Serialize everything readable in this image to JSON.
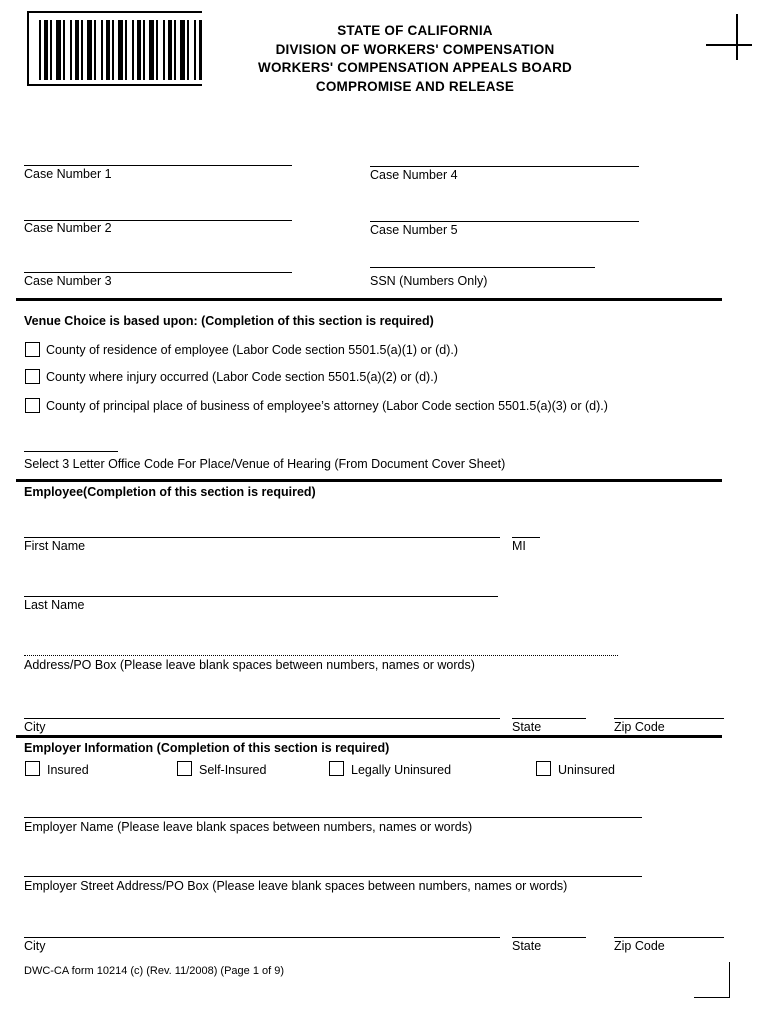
{
  "header": {
    "line1": "STATE OF CALIFORNIA",
    "line2": "DIVISION OF WORKERS' COMPENSATION",
    "line3": "WORKERS' COMPENSATION APPEALS BOARD",
    "line4": "COMPROMISE AND RELEASE"
  },
  "case_fields": {
    "case1": "Case Number 1",
    "case2": "Case Number 2",
    "case3": "Case Number 3",
    "case4": "Case Number 4",
    "case5": "Case Number 5",
    "ssn": "SSN (Numbers Only)"
  },
  "venue": {
    "heading": "Venue Choice is based upon:  (Completion of this section is required)",
    "options": [
      "County of residence of employee (Labor Code section 5501.5(a)(1) or (d).)",
      "County where injury occurred (Labor Code section 5501.5(a)(2) or (d).)",
      "County of principal place of business of employee’s attorney (Labor Code section 5501.5(a)(3) or (d).)"
    ],
    "office_code_label": "Select 3 Letter Office Code For Place/Venue of Hearing (From Document Cover Sheet)"
  },
  "employee": {
    "heading": "Employee(Completion of this section is required)",
    "first_name": "First Name",
    "mi": "MI",
    "last_name": "Last Name",
    "address": "Address/PO Box (Please leave blank spaces between numbers, names or words)",
    "city": "City",
    "state": "State",
    "zip": "Zip Code"
  },
  "employer": {
    "heading": "Employer Information (Completion of this section is required)",
    "insurance_options": [
      "Insured",
      "Self-Insured",
      "Legally Uninsured",
      "Uninsured"
    ],
    "name": "Employer Name (Please leave blank spaces between numbers, names or words)",
    "street": "Employer Street Address/PO Box (Please leave blank spaces between numbers, names or words)",
    "city": "City",
    "state": "State",
    "zip": "Zip Code"
  },
  "footer": {
    "text": "DWC-CA form 10214 (c) (Rev. 11/2008) (Page 1 of 9)"
  }
}
